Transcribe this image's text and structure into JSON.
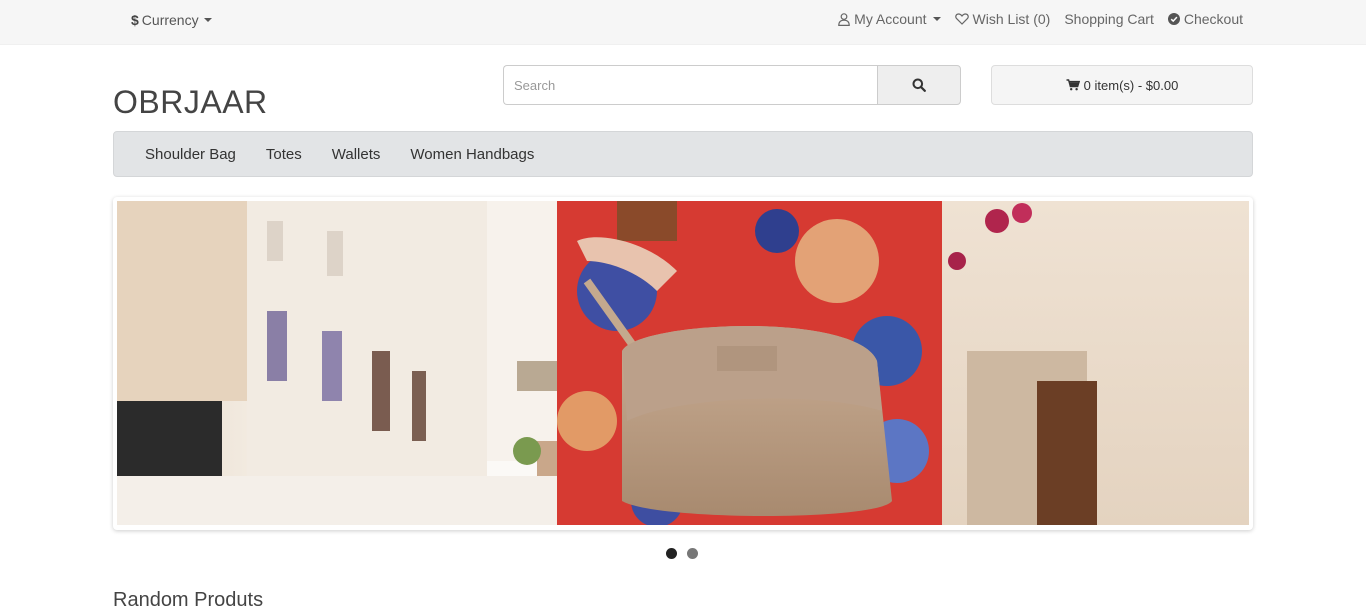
{
  "topbar": {
    "currency_symbol": "$",
    "currency_label": "Currency",
    "my_account": "My Account",
    "wish_list": "Wish List (0)",
    "shopping_cart": "Shopping Cart",
    "checkout": "Checkout"
  },
  "logo": "OBRJAAR",
  "search": {
    "placeholder": "Search"
  },
  "cart": {
    "label": "0 item(s) - $0.00"
  },
  "menu": {
    "items": [
      "Shoulder Bag",
      "Totes",
      "Wallets",
      "Women Handbags"
    ]
  },
  "slider": {
    "slide_count": 2,
    "active_slide": 1
  },
  "sections": {
    "random_products_title": "Random Produts"
  },
  "icons": {
    "user": "user-icon",
    "heart": "heart-icon",
    "check": "check-circle-icon",
    "search": "search-icon",
    "cart": "cart-icon"
  }
}
